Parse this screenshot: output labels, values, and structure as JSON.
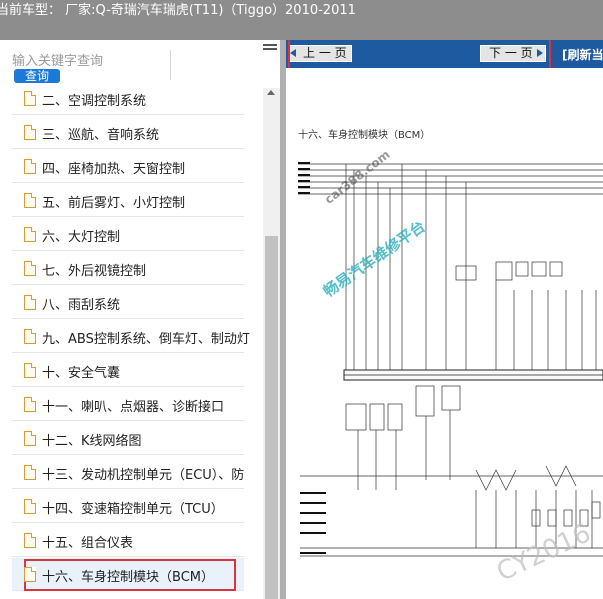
{
  "header": {
    "title": "当前车型：  厂家:Q-奇瑞汽车瑞虎(T11)（Tiggo）2010-2011"
  },
  "sidebar": {
    "search_placeholder": "输入关键字查询",
    "search_button": "查询",
    "items": [
      {
        "label": "二、空调控制系统"
      },
      {
        "label": "三、巡航、音响系统"
      },
      {
        "label": "四、座椅加热、天窗控制"
      },
      {
        "label": "五、前后雾灯、小灯控制"
      },
      {
        "label": "六、大灯控制"
      },
      {
        "label": "七、外后视镜控制"
      },
      {
        "label": "八、雨刮系统"
      },
      {
        "label": "九、ABS控制系统、倒车灯、制动灯"
      },
      {
        "label": "十、安全气囊"
      },
      {
        "label": "十一、喇叭、点烟器、诊断接口"
      },
      {
        "label": "十二、K线网络图"
      },
      {
        "label": "十三、发动机控制单元（ECU）、防"
      },
      {
        "label": "十四、变速箱控制单元（TCU）"
      },
      {
        "label": "十五、组合仪表"
      },
      {
        "label": "十六、车身控制模块（BCM）",
        "active": true
      }
    ]
  },
  "viewer": {
    "prev_label": "上 一 页",
    "next_label": "下 一 页",
    "refresh_label": "[刷新当",
    "diagram_title": "十六、车身控制模块（BCM）",
    "watermark_site": "car388.com",
    "watermark_platform": "畅易汽车维修平台",
    "watermark_corner": "CY2016"
  },
  "colors": {
    "header_bg": "#8d8d8d",
    "accent_blue": "#1d5aa0",
    "search_button": "#1c79d6",
    "highlight_red": "#d9333f"
  }
}
